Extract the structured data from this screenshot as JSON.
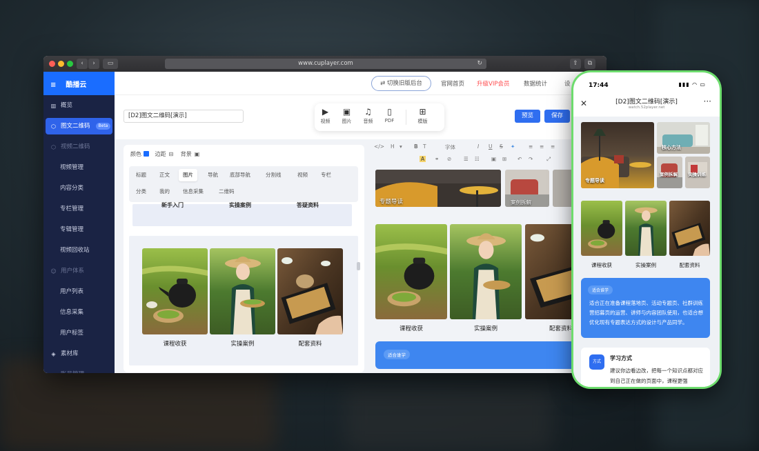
{
  "browser": {
    "url": "www.cuplayer.com"
  },
  "sidebar": {
    "brand": "酷播云",
    "items": [
      {
        "label": "概览",
        "icon": "chart-icon",
        "type": "top"
      },
      {
        "label": "图文二维码",
        "icon": "cube-icon",
        "type": "active",
        "badge": "Beta"
      },
      {
        "label": "视频二维码",
        "icon": "cube-icon",
        "type": "grp"
      },
      {
        "label": "视频管理",
        "type": "sub"
      },
      {
        "label": "内容分类",
        "type": "sub"
      },
      {
        "label": "专栏管理",
        "type": "sub"
      },
      {
        "label": "专辑管理",
        "type": "sub"
      },
      {
        "label": "视频回收站",
        "type": "sub"
      },
      {
        "label": "用户体系",
        "icon": "user-icon",
        "type": "grp"
      },
      {
        "label": "用户列表",
        "type": "sub"
      },
      {
        "label": "信息采集",
        "type": "sub"
      },
      {
        "label": "用户标签",
        "type": "sub"
      },
      {
        "label": "素材库",
        "icon": "layers-icon",
        "type": "top"
      },
      {
        "label": "账号管理",
        "icon": "id-icon",
        "type": "grp"
      }
    ]
  },
  "topnav": {
    "switch": "切换旧版后台",
    "links": [
      "官网首页",
      "升级VIP会员",
      "数据统计",
      "设"
    ]
  },
  "toolbar": {
    "title_value": "[D2]图文二维码[演示]",
    "tools": [
      "视频",
      "图片",
      "音频",
      "PDF",
      "模版"
    ],
    "preview": "预览",
    "save": "保存"
  },
  "panel": {
    "color_label": "颜色",
    "border_label": "边距",
    "bg_label": "背景",
    "tabs_row1": [
      "标题",
      "正文",
      "图片",
      "导航",
      "底部导航",
      "分割线",
      "视频",
      "专栏"
    ],
    "tabs_row2": [
      "分类",
      "我的",
      "信息采集",
      "二维码"
    ],
    "cut_labels": [
      "新手入门",
      "实操案例",
      "答疑资料"
    ],
    "gallery": [
      "课程收获",
      "实操案例",
      "配套资料"
    ]
  },
  "preview": {
    "editor": [
      "</>",
      "H",
      "B",
      "T",
      "字体",
      "I",
      "U",
      "S",
      "A"
    ],
    "top_caps": [
      "专题导读",
      "案例拆解"
    ],
    "captions": [
      "课程收获",
      "实操案例",
      "配套资料"
    ],
    "tag": "适合谁学"
  },
  "phone": {
    "time": "17:44",
    "title": "[D2]图文二维码[演示]",
    "subtitle": "watch.52player.net",
    "top_caps": [
      "专题导读",
      "核心方法",
      "案例拆解",
      "实操训练"
    ],
    "captions": [
      "课程收获",
      "实操案例",
      "配套资料"
    ],
    "tag": "适合谁学",
    "who_text": "适合正在准备课程落地页、活动专题页、社群训练营招募页的运营、讲师与内容团队使用，也适合想优化现有专题表达方式的设计与产品同学。",
    "method_icon": "方式",
    "method_title": "学习方式",
    "method_text": "建议你边看边改，把每一个知识点都对应到自己正在做的页面中，课程更强"
  },
  "colors": {
    "accent": "#1a6dff",
    "sidebar": "#1a2344",
    "vip": "#ff4d4f",
    "phone_frame": "#6ddc6d"
  }
}
